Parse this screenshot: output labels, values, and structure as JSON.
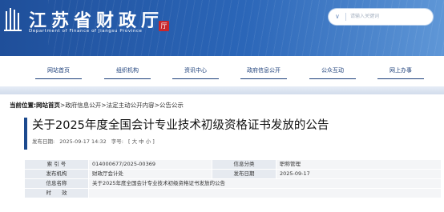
{
  "header": {
    "title_cn": "江苏省财政厅",
    "title_en": "Department of Finance of Jiangsu Province",
    "seal_text": "厅",
    "search_placeholder": "请输入关键词"
  },
  "nav": {
    "items": [
      {
        "label": "网站首页"
      },
      {
        "label": "组织机构"
      },
      {
        "label": "资讯中心"
      },
      {
        "label": "政府信息公开"
      },
      {
        "label": "公众互动"
      },
      {
        "label": "网上办事"
      }
    ]
  },
  "breadcrumb": {
    "prefix": "当前位置:",
    "home": "网站首页",
    "trail": ">政府信息公开>法定主动公开内容>公告公示"
  },
  "article": {
    "title": "关于2025年度全国会计专业技术初级资格证书发放的公告",
    "publish_label": "发布日期:",
    "publish_date": "2025-09-17  14:32",
    "font_label": "字号:",
    "font_options": "[ 大 中 小 ]"
  },
  "info_table": {
    "index_label": "索 引 号",
    "index_value": "014000677/2025-00369",
    "category_label": "信息分类",
    "category_value": "职称管理",
    "org_label": "发布机构",
    "org_value": "财政厅会计处",
    "date_label": "发布日期",
    "date_value": "2025-09-17",
    "name_label": "信息名称",
    "name_value": "关于2025年度全国会计专业技术初级资格证书发放的公告",
    "valid_label": "时　　效",
    "valid_value": ""
  },
  "colors": {
    "header_blue": "#1f4f9a",
    "nav_text": "#1c3f7a",
    "seal_red": "#c8272d"
  }
}
